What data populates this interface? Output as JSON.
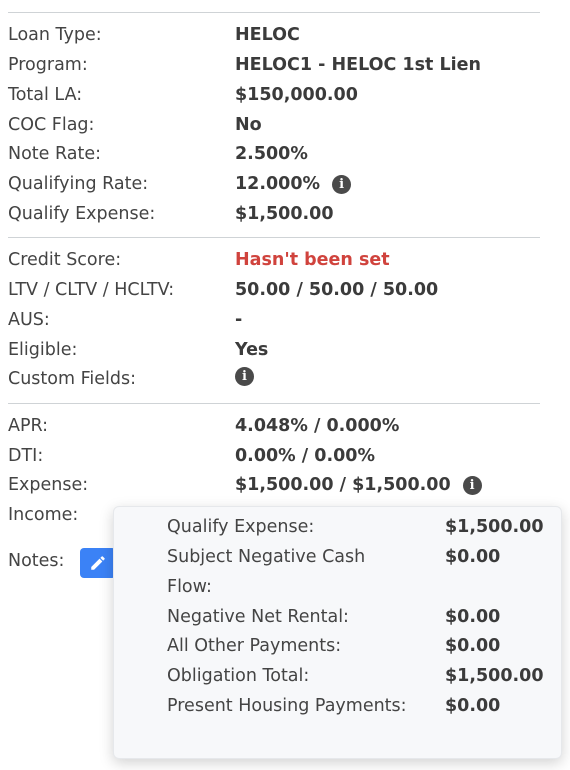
{
  "loan": {
    "loan_type": {
      "label": "Loan Type:",
      "value": "HELOC"
    },
    "program": {
      "label": "Program:",
      "value": "HELOC1 - HELOC 1st Lien"
    },
    "total_la": {
      "label": "Total LA:",
      "value": "$150,000.00"
    },
    "coc_flag": {
      "label": "COC Flag:",
      "value": "No"
    },
    "note_rate": {
      "label": "Note Rate:",
      "value": "2.500%"
    },
    "qualifying_rate": {
      "label": "Qualifying Rate:",
      "value": "12.000%"
    },
    "qualify_expense": {
      "label": "Qualify Expense:",
      "value": "$1,500.00"
    }
  },
  "credit": {
    "credit_score": {
      "label": "Credit Score:",
      "value": "Hasn't been set"
    },
    "ltv": {
      "label": "LTV / CLTV / HCLTV:",
      "value": "50.00 / 50.00 / 50.00"
    },
    "aus": {
      "label": "AUS:",
      "value": "-"
    },
    "eligible": {
      "label": "Eligible:",
      "value": "Yes"
    },
    "custom_fields": {
      "label": "Custom Fields:"
    }
  },
  "financial": {
    "apr": {
      "label": "APR:",
      "value": "4.048% / 0.000%"
    },
    "dti": {
      "label": "DTI:",
      "value": "0.00% / 0.00%"
    },
    "expense": {
      "label": "Expense:",
      "value": "$1,500.00 / $1,500.00"
    },
    "income": {
      "label": "Income:"
    }
  },
  "notes": {
    "label": "Notes:"
  },
  "popover": {
    "rows": [
      {
        "label": "Qualify Expense:",
        "value": "$1,500.00"
      },
      {
        "label": "Subject Negative Cash Flow:",
        "value": "$0.00"
      },
      {
        "label": "Negative Net Rental:",
        "value": "$0.00"
      },
      {
        "label": "All Other Payments:",
        "value": "$0.00"
      },
      {
        "label": "Obligation Total:",
        "value": "$1,500.00"
      },
      {
        "label": "Present Housing Payments:",
        "value": "$0.00"
      }
    ]
  },
  "icons": {
    "info": "info-icon",
    "edit": "pencil-icon"
  },
  "colors": {
    "accent": "#3b82f6",
    "error_text": "#d0433d",
    "divider": "#cfd3d6"
  }
}
